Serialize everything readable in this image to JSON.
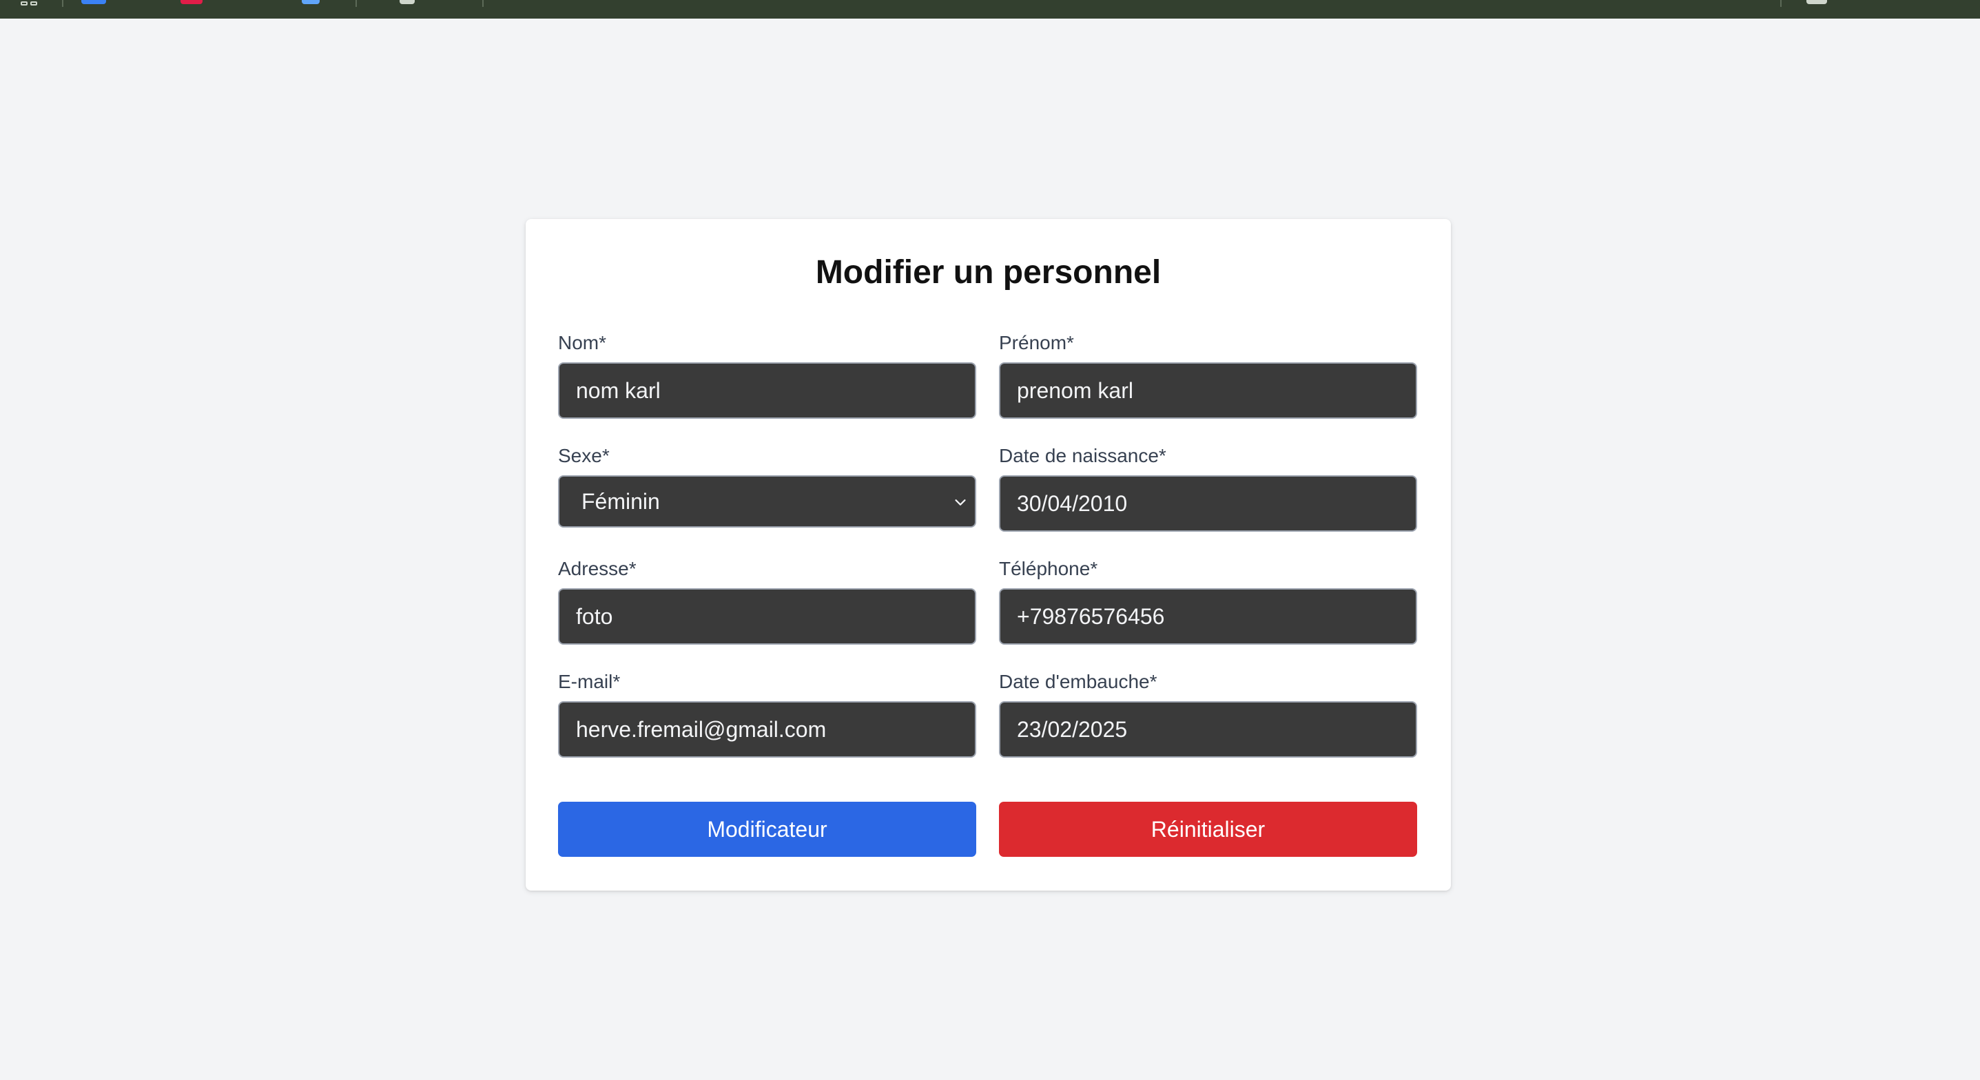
{
  "colors": {
    "topbar": "#33402f",
    "page_bg": "#f3f4f6",
    "input_bg": "#3a3a3a",
    "primary": "#2b67e4",
    "danger": "#dc2a2f"
  },
  "form": {
    "title": "Modifier un personnel",
    "fields": {
      "nom": {
        "label": "Nom*",
        "value": "nom karl"
      },
      "prenom": {
        "label": "Prénom*",
        "value": "prenom karl"
      },
      "sexe": {
        "label": "Sexe*",
        "value": "Féminin",
        "icon": "chevron-down-icon"
      },
      "date_naissance": {
        "label": "Date de naissance*",
        "value": "30/04/2010"
      },
      "adresse": {
        "label": "Adresse*",
        "value": "foto"
      },
      "telephone": {
        "label": "Téléphone*",
        "value": "+79876576456"
      },
      "email": {
        "label": "E-mail*",
        "value": "herve.fremail@gmail.com"
      },
      "date_embauche": {
        "label": "Date d'embauche*",
        "value": "23/02/2025"
      }
    },
    "buttons": {
      "submit": "Modificateur",
      "reset": "Réinitialiser"
    }
  }
}
